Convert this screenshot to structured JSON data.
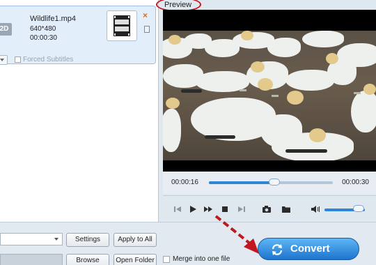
{
  "file": {
    "badge": "2D",
    "name": "Wildlife1.mp4",
    "resolution": "640*480",
    "duration": "00:00:30",
    "close": "×",
    "forced_subtitles": "Forced Subtitles"
  },
  "preview": {
    "label": "Preview",
    "time_current": "00:00:16",
    "time_total": "00:00:30",
    "progress_fraction": 0.53,
    "volume_fraction": 0.85
  },
  "toolbar": {
    "settings": "Settings",
    "apply_to_all": "Apply to All",
    "browse": "Browse",
    "open_folder": "Open Folder",
    "merge_label": "Merge into one file",
    "convert": "Convert"
  },
  "icons": [
    "skip-back-icon",
    "play-icon",
    "fast-forward-icon",
    "stop-icon",
    "skip-forward-icon",
    "camera-icon",
    "folder-icon",
    "volume-icon",
    "refresh-icon",
    "film-icon",
    "edit-icon",
    "arrow-icon"
  ],
  "colors": {
    "accent": "#2e84d6",
    "convert": "#1d74cf",
    "annotation": "#c0181e"
  }
}
